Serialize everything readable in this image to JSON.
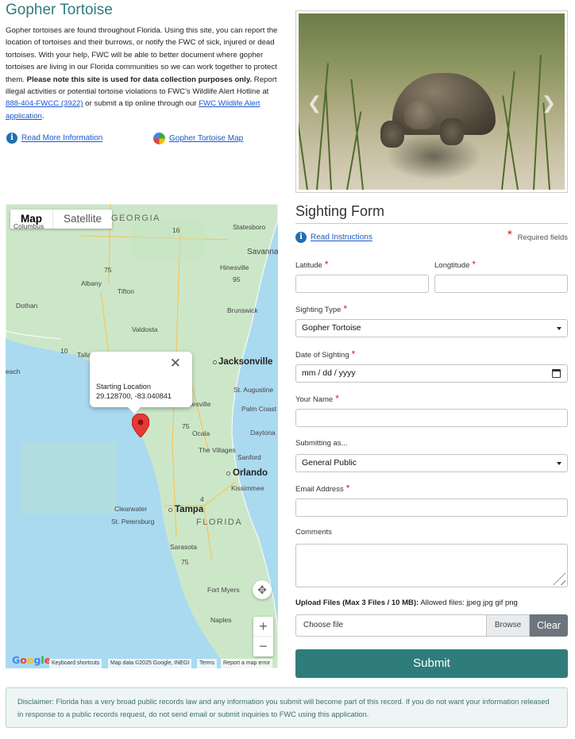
{
  "header": {
    "title": "Gopher Tortoise",
    "intro_1": "Gopher tortoises are found throughout Florida. Using this site, you can report the location of tortoises and their burrows, or notify the FWC of sick, injured or dead tortoises. With your help, FWC will be able to better document where gopher tortoises are living in our Florida communities so we can work together to protect them.",
    "intro_bold": "Please note this site is used for data collection purposes only.",
    "intro_2": "Report illegal activities or potential tortoise violations to FWC's Wildlife Alert Hotline at",
    "hotline_link": "888-404-FWCC (3922)",
    "intro_3": "or submit a tip online through our",
    "wildlife_alert_link": "FWC Wildlife Alert application",
    "intro_end": ".",
    "read_more_link": "Read More Information",
    "map_link": "Gopher Tortoise Map"
  },
  "photo": {
    "prev_icon": "chevron-left-icon",
    "next_icon": "chevron-right-icon"
  },
  "map": {
    "tab_map": "Map",
    "tab_satellite": "Satellite",
    "popup_title": "Starting Location",
    "popup_coords": "29.128700, -83.040841",
    "popup_close": "✕",
    "zoom_in": "+",
    "zoom_out": "−",
    "google": "Google",
    "footer_shortcuts": "Keyboard shortcuts",
    "footer_data": "Map data ©2025 Google, INEGI",
    "footer_terms": "Terms",
    "footer_report": "Report a map error",
    "labels": {
      "georgia": "GEORGIA",
      "columbus": "Columbus",
      "statesboro": "Statesboro",
      "savannah": "Savannah",
      "hinesville": "Hinesville",
      "albany": "Albany",
      "tifton": "Tifton",
      "dothan": "Dothan",
      "brunswick": "Brunswick",
      "valdosta": "Valdosta",
      "tallahassee": "Talla",
      "beach": "each",
      "jacksonville": "Jacksonville",
      "st_augustine": "St. Augustine",
      "gainesville": "nesville",
      "palm_coast": "Palm Coast",
      "ocala": "Ocala",
      "daytona": "Daytona",
      "villages": "The Villages",
      "sanford": "Sanford",
      "orlando": "Orlando",
      "kissimmee": "Kissimmee",
      "clearwater": "Clearwater",
      "tampa": "Tampa",
      "st_pete": "St. Petersburg",
      "florida": "FLORIDA",
      "sarasota": "Sarasota",
      "fort_myers": "Fort Myers",
      "naples": "Naples",
      "hwy_16": "16",
      "hwy_75a": "75",
      "hwy_95a": "95",
      "hwy_10": "10",
      "hwy_75b": "75",
      "hwy_4": "4",
      "hwy_75c": "75"
    }
  },
  "form": {
    "title": "Sighting Form",
    "read_instructions": "Read Instructions",
    "required_star": "*",
    "required_note": "Required fields",
    "latitude_label": "Latitude",
    "longitude_label": "Longtitude",
    "latitude_value": "",
    "longitude_value": "",
    "sighting_type_label": "Sighting Type",
    "sighting_type_value": "Gopher Tortoise",
    "date_label": "Date of Sighting",
    "date_placeholder": "mm / dd / yyyy",
    "name_label": "Your Name",
    "name_value": "",
    "submitting_label": "Submitting as...",
    "submitting_value": "General Public",
    "email_label": "Email Address",
    "email_value": "",
    "comments_label": "Comments",
    "comments_value": "",
    "upload_label_bold": "Upload Files (Max 3 Files / 10 MB):",
    "upload_label_rest": " Allowed files: jpeg jpg gif png",
    "choose_file": "Choose file",
    "browse": "Browse",
    "clear": "Clear",
    "submit": "Submit"
  },
  "disclaimer": "Disclaimer: Florida has a very broad public records law and any information you submit will become part of this record. If you do not want your information released in response to a public records request, do not send email or submit inquiries to FWC using this application.",
  "colors": {
    "brand_teal": "#2e7d7b",
    "link_blue": "#1a57c9",
    "required_red": "#cc2222",
    "clear_gray": "#6c757d"
  }
}
